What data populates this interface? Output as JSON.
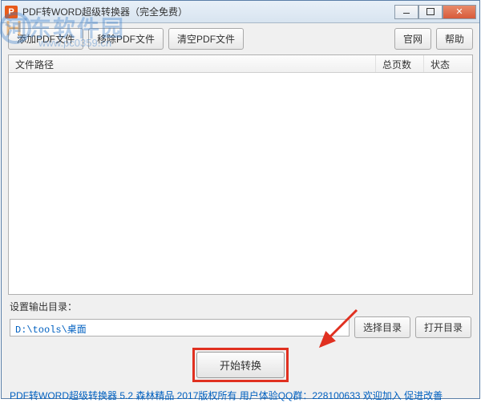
{
  "window": {
    "title": "PDF转WORD超级转换器（完全免费）",
    "icon_letter": "P"
  },
  "toolbar": {
    "add_pdf": "添加PDF文件",
    "remove_pdf": "移除PDF文件",
    "clear_pdf": "清空PDF文件",
    "official": "官网",
    "help": "帮助"
  },
  "list": {
    "col_path": "文件路径",
    "col_pages": "总页数",
    "col_status": "状态"
  },
  "output": {
    "label": "设置输出目录：",
    "path": "D:\\tools\\桌面",
    "choose_dir": "选择目录",
    "open_dir": "打开目录"
  },
  "convert": {
    "label": "开始转换"
  },
  "footer": {
    "text": "PDF转WORD超级转换器 5.2 森林精品 2017版权所有 用户体验QQ群：228100633 欢迎加入 促进改善"
  },
  "watermark": {
    "text": "河东软件园",
    "sub": "www.pc0359.cn"
  }
}
